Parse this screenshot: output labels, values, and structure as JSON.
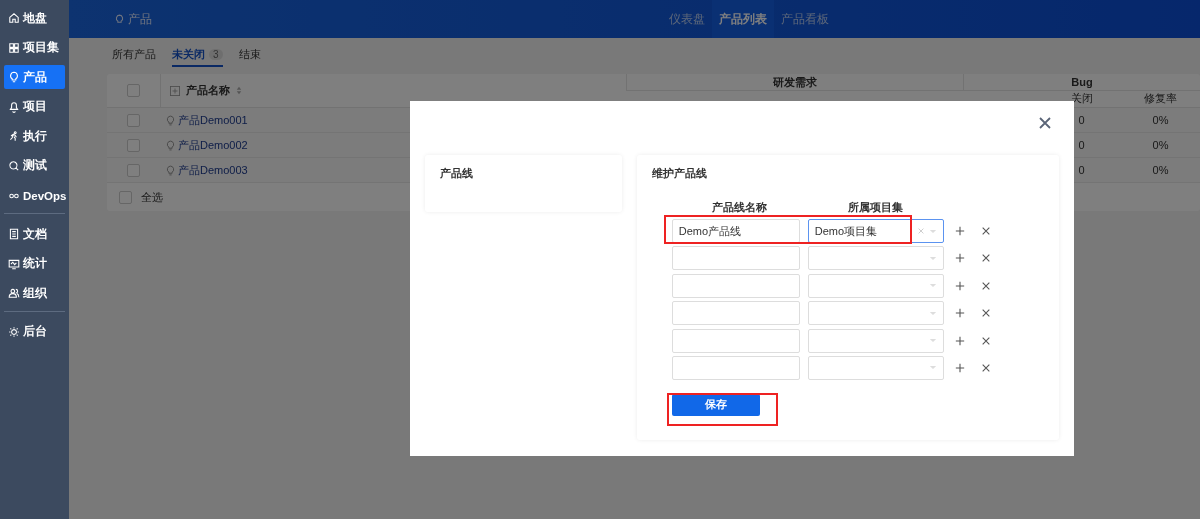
{
  "sidebar": {
    "groups": [
      [
        {
          "label": "地盘",
          "selected": false
        },
        {
          "label": "项目集",
          "selected": false
        },
        {
          "label": "产品",
          "selected": true
        },
        {
          "label": "项目",
          "selected": false
        },
        {
          "label": "执行",
          "selected": false
        },
        {
          "label": "测试",
          "selected": false
        },
        {
          "label": "DevOps",
          "selected": false
        }
      ],
      [
        {
          "label": "文档",
          "selected": false
        },
        {
          "label": "统计",
          "selected": false
        },
        {
          "label": "组织",
          "selected": false
        }
      ],
      [
        {
          "label": "后台",
          "selected": false
        }
      ]
    ]
  },
  "topbar": {
    "breadcrumb": "产品",
    "nav": [
      {
        "label": "仪表盘",
        "selected": false
      },
      {
        "label": "产品列表",
        "selected": true
      },
      {
        "label": "产品看板",
        "selected": false
      }
    ]
  },
  "tabs": [
    {
      "label": "所有产品",
      "selected": false
    },
    {
      "label": "未关闭",
      "selected": true,
      "count": "3"
    },
    {
      "label": "结束",
      "selected": false
    }
  ],
  "table": {
    "header_checked": false,
    "name_column": "产品名称",
    "groups": [
      {
        "label": "研发需求"
      },
      {
        "label": "Bug"
      }
    ],
    "subheaders": [
      "关闭",
      "修复率"
    ],
    "rows": [
      {
        "name": "产品Demo001",
        "checked": false,
        "bug_closed": "0",
        "fix_rate": "0%"
      },
      {
        "name": "产品Demo002",
        "checked": false,
        "bug_closed": "0",
        "fix_rate": "0%"
      },
      {
        "name": "产品Demo003",
        "checked": false,
        "bug_closed": "0",
        "fix_rate": "0%"
      }
    ],
    "footer": {
      "label": "全选",
      "checked": false
    }
  },
  "dialog": {
    "side_card": {
      "title": "产品线"
    },
    "form": {
      "title": "维护产品线",
      "columns": [
        "产品线名称",
        "所属项目集"
      ],
      "rows": [
        {
          "name": "Demo产品线",
          "program": "Demo项目集",
          "focused": true,
          "highlighted": true
        },
        {
          "focused": false,
          "highlighted": false
        },
        {
          "focused": false,
          "highlighted": false
        },
        {
          "focused": false,
          "highlighted": false
        },
        {
          "focused": false,
          "highlighted": false
        },
        {
          "focused": false,
          "highlighted": false
        }
      ],
      "save": {
        "label": "保存",
        "highlighted": true
      }
    }
  }
}
